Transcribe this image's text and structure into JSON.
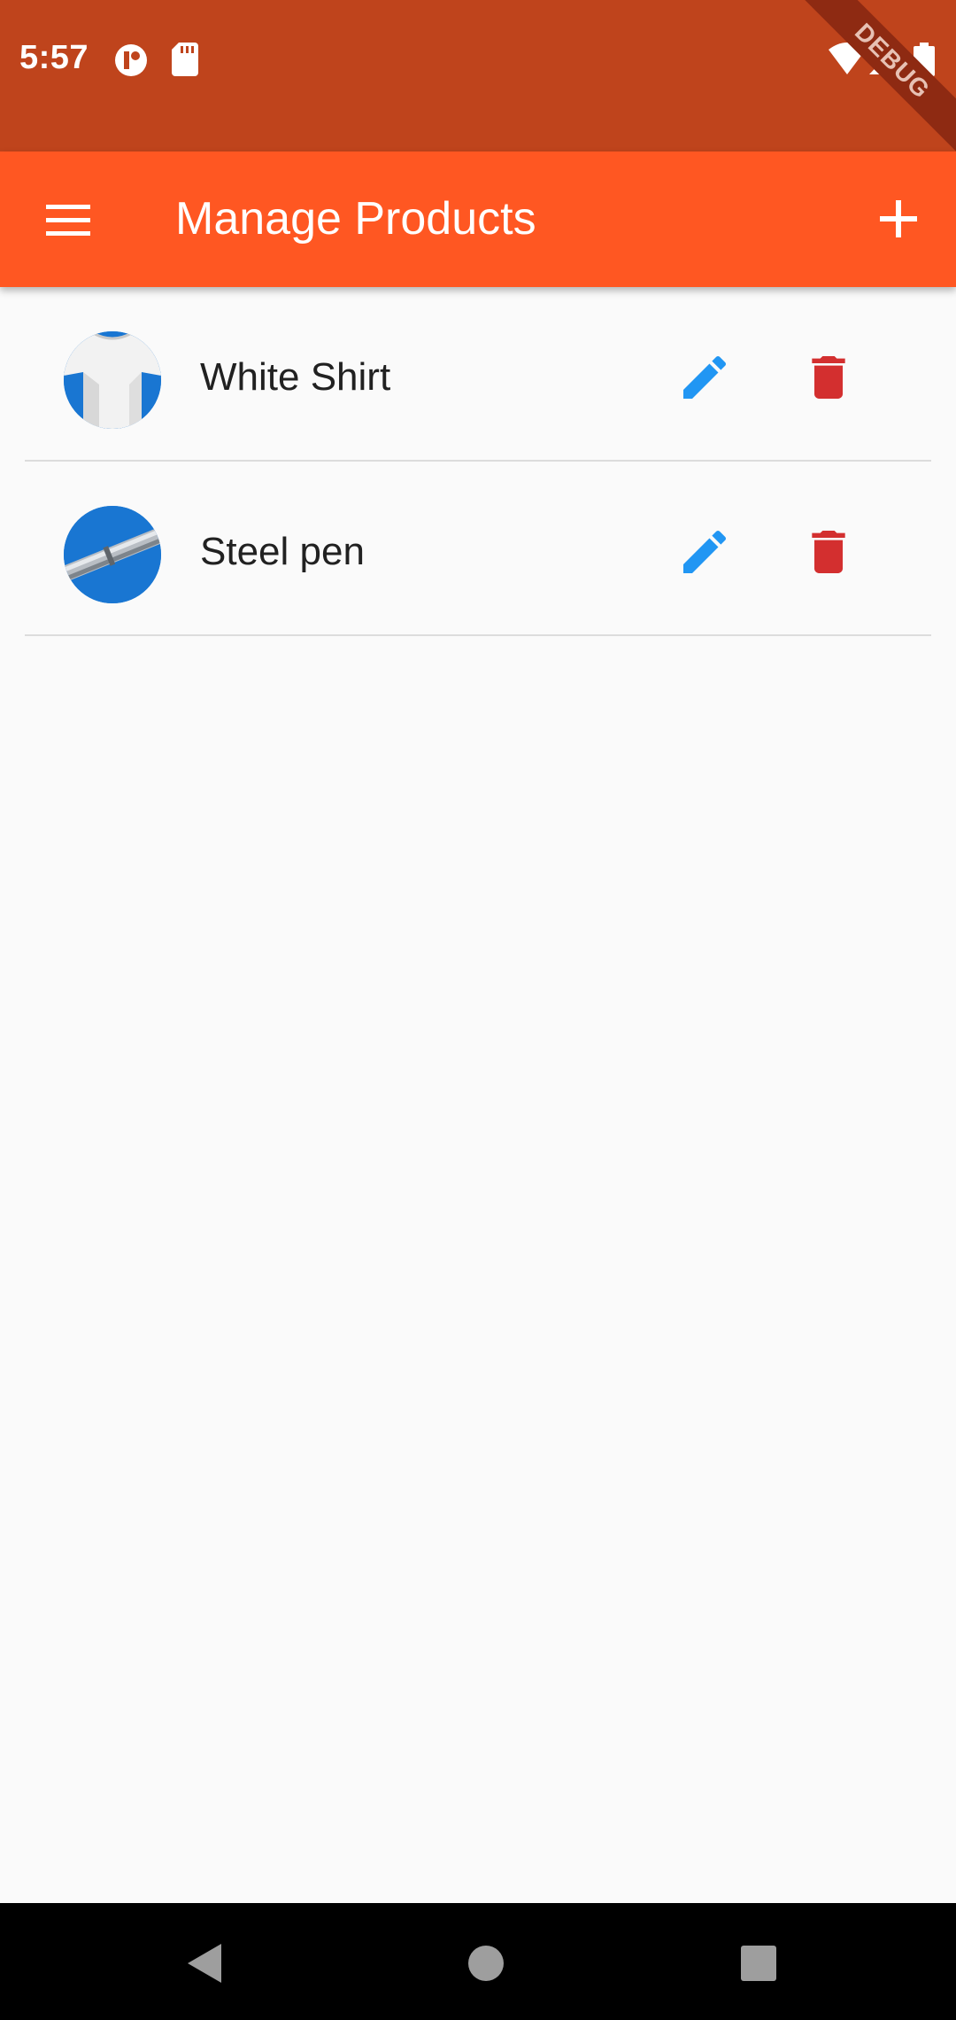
{
  "status_bar": {
    "time": "5:57",
    "debug_label": "DEBUG",
    "icons": [
      "app-notification-icon",
      "sd-card-icon",
      "wifi-icon",
      "signal-icon",
      "battery-icon"
    ]
  },
  "app_bar": {
    "title": "Manage Products",
    "menu_icon": "menu-icon",
    "add_icon": "add-icon",
    "background": "#ff5722"
  },
  "products": [
    {
      "title": "White Shirt",
      "image": "white-shirt-thumbnail",
      "edit_icon": "pencil-icon",
      "delete_icon": "trash-icon"
    },
    {
      "title": "Steel pen",
      "image": "steel-pen-thumbnail",
      "edit_icon": "pencil-icon",
      "delete_icon": "trash-icon"
    }
  ],
  "colors": {
    "status_bar": "#bf441c",
    "edit": "#2196f3",
    "delete": "#d32f2f",
    "avatar_bg": "#1976d2"
  },
  "nav_bar": {
    "buttons": [
      "back-icon",
      "home-icon",
      "recent-apps-icon"
    ]
  }
}
